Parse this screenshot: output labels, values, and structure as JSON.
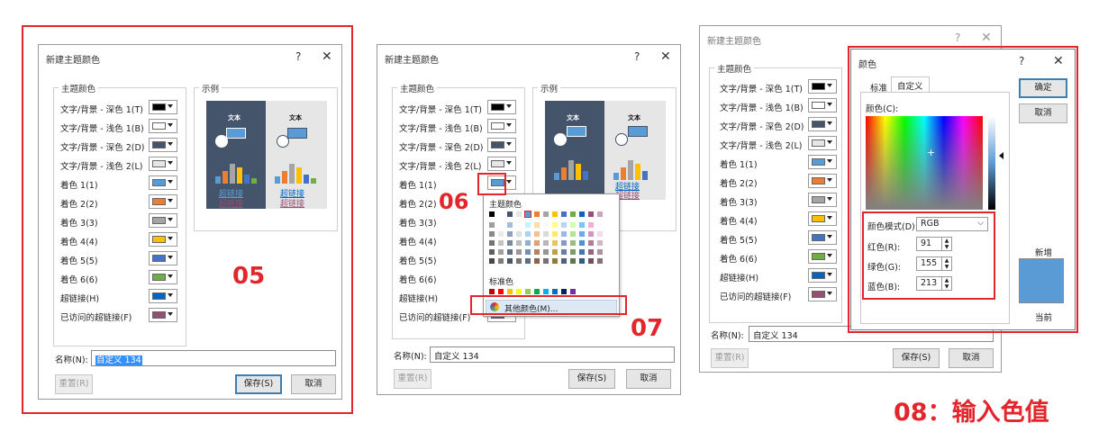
{
  "dialog1": {
    "title": "新建主题颜色",
    "help": "?",
    "close": "✕",
    "theme_group": "主题颜色",
    "sample_group": "示例",
    "rows": [
      {
        "label": "文字/背景 - 深色 1(T)",
        "color": "#000000"
      },
      {
        "label": "文字/背景 - 浅色 1(B)",
        "color": "#ffffff"
      },
      {
        "label": "文字/背景 - 深色 2(D)",
        "color": "#44546a"
      },
      {
        "label": "文字/背景 - 浅色 2(L)",
        "color": "#e7e6e6"
      },
      {
        "label": "着色 1(1)",
        "color": "#5b9bd5"
      },
      {
        "label": "着色 2(2)",
        "color": "#ed7d31"
      },
      {
        "label": "着色 3(3)",
        "color": "#a5a5a5"
      },
      {
        "label": "着色 4(4)",
        "color": "#ffc000"
      },
      {
        "label": "着色 5(5)",
        "color": "#4472c4"
      },
      {
        "label": "着色 6(6)",
        "color": "#70ad47"
      },
      {
        "label": "超链接(H)",
        "color": "#0563c1"
      },
      {
        "label": "已访问的超链接(F)",
        "color": "#954f72"
      }
    ],
    "preview_text": "文本",
    "hyperlink": "超链接",
    "visited_hyperlink": "超链接",
    "name_label": "名称(N):",
    "name_value": "自定义 134",
    "reset": "重置(R)",
    "save": "保存(S)",
    "cancel": "取消"
  },
  "dialog2": {
    "popup_theme_title": "主题颜色",
    "popup_standard_title": "标准色",
    "more_colors": "其他颜色(M)...",
    "name_value": "自定义 134"
  },
  "dialog3": {
    "picker_title": "颜色",
    "tab_standard": "标准",
    "tab_custom": "自定义",
    "colors_label": "颜色(C):",
    "ok": "确定",
    "cancel": "取消",
    "mode_label": "颜色模式(D):",
    "mode_value": "RGB",
    "red_label": "红色(R):",
    "red_value": "91",
    "green_label": "绿色(G):",
    "green_value": "155",
    "blue_label": "蓝色(B):",
    "blue_value": "213",
    "new_label": "新增",
    "current_label": "当前",
    "new_color": "#5b9bd5",
    "name_value": "自定义 134"
  },
  "annotations": {
    "step05": "05",
    "step06": "06",
    "step07": "07",
    "step08": "08：输入色值"
  },
  "colors": {
    "annotation_red": "#e3262b",
    "dark_preview": "#44546a",
    "light_preview": "#e7e6e6"
  }
}
